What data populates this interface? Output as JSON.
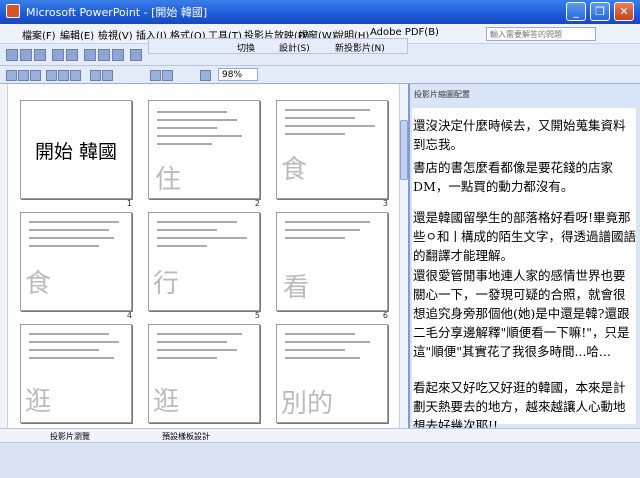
{
  "window": {
    "title": "Microsoft PowerPoint - [開始 韓國]",
    "minimize": "_",
    "restore": "❐",
    "close": "✕"
  },
  "menu": [
    "檔案(F)",
    "編輯(E)",
    "檢視(V)",
    "插入(I)",
    "格式(O)",
    "工具(T)",
    "投影片放映(D)",
    "視窗(W)",
    "說明(H)",
    "Adobe PDF(B)"
  ],
  "help_placeholder": "輸入需要解答的問題",
  "review_toolbar": [
    "切換",
    "設計(S)",
    "新投影片(N)"
  ],
  "zoom": "98%",
  "slides": [
    {
      "num": "1",
      "title": "開始 韓國",
      "big": ""
    },
    {
      "num": "2",
      "title": "",
      "big": "住"
    },
    {
      "num": "3",
      "title": "",
      "big": "食"
    },
    {
      "num": "4",
      "title": "",
      "big": "食"
    },
    {
      "num": "5",
      "title": "",
      "big": "行"
    },
    {
      "num": "6",
      "title": "",
      "big": "看"
    },
    {
      "num": "7",
      "title": "",
      "big": "逛"
    },
    {
      "num": "8",
      "title": "",
      "big": "逛"
    },
    {
      "num": "9",
      "title": "",
      "big": "別的"
    }
  ],
  "pane": {
    "header": "投影片縮圖配置",
    "notes": [
      "還沒決定什麼時候去，又開始蒐集資料到忘我。",
      "書店的書怎麼看都像是要花錢的店家DM，一點買的動力都沒有。",
      "還是韓國留學生的部落格好看呀!畢竟那些ㅇ和ㅣ構成的陌生文字，得透過譜國語的翻譯才能理解。",
      "還很愛管閒事地連人家的感情世界也要關心一下，一發現可疑的合照，就會很想追究身旁那個他(她)是中還是韓?還跟二毛分享邊解釋\"順便看一下嘛!\"，只是這\"順便\"其實花了我很多時間...哈...",
      "看起來又好吃又好逛的韓國，本來是計劃天熱要去的地方，越來越讓人心動地想去好幾次耶!!"
    ]
  },
  "tabs": [
    "投影片瀏覽",
    "預設樣板設計"
  ]
}
